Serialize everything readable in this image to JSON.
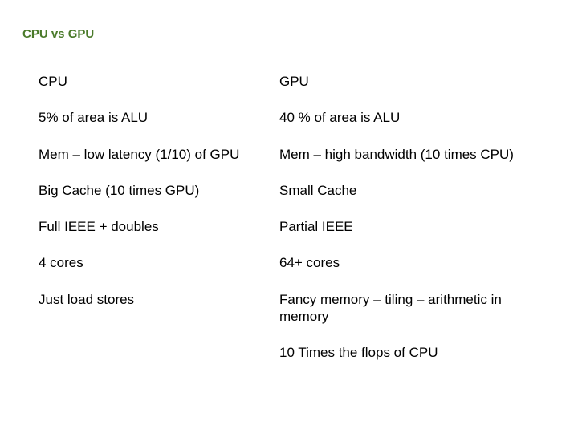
{
  "title": "CPU vs GPU",
  "chart_data": {
    "type": "table",
    "title": "CPU vs GPU",
    "columns": [
      "CPU",
      "GPU"
    ],
    "rows": [
      [
        "5% of area is ALU",
        "40 % of area is ALU"
      ],
      [
        "Mem – low latency (1/10) of GPU",
        "Mem – high bandwidth (10 times CPU)"
      ],
      [
        "Big Cache (10 times GPU)",
        "Small Cache"
      ],
      [
        "Full IEEE + doubles",
        "Partial IEEE"
      ],
      [
        "4 cores",
        "64+ cores"
      ],
      [
        "Just load stores",
        "Fancy memory – tiling – arithmetic  in memory"
      ],
      [
        "",
        "10 Times the flops of CPU"
      ]
    ]
  }
}
